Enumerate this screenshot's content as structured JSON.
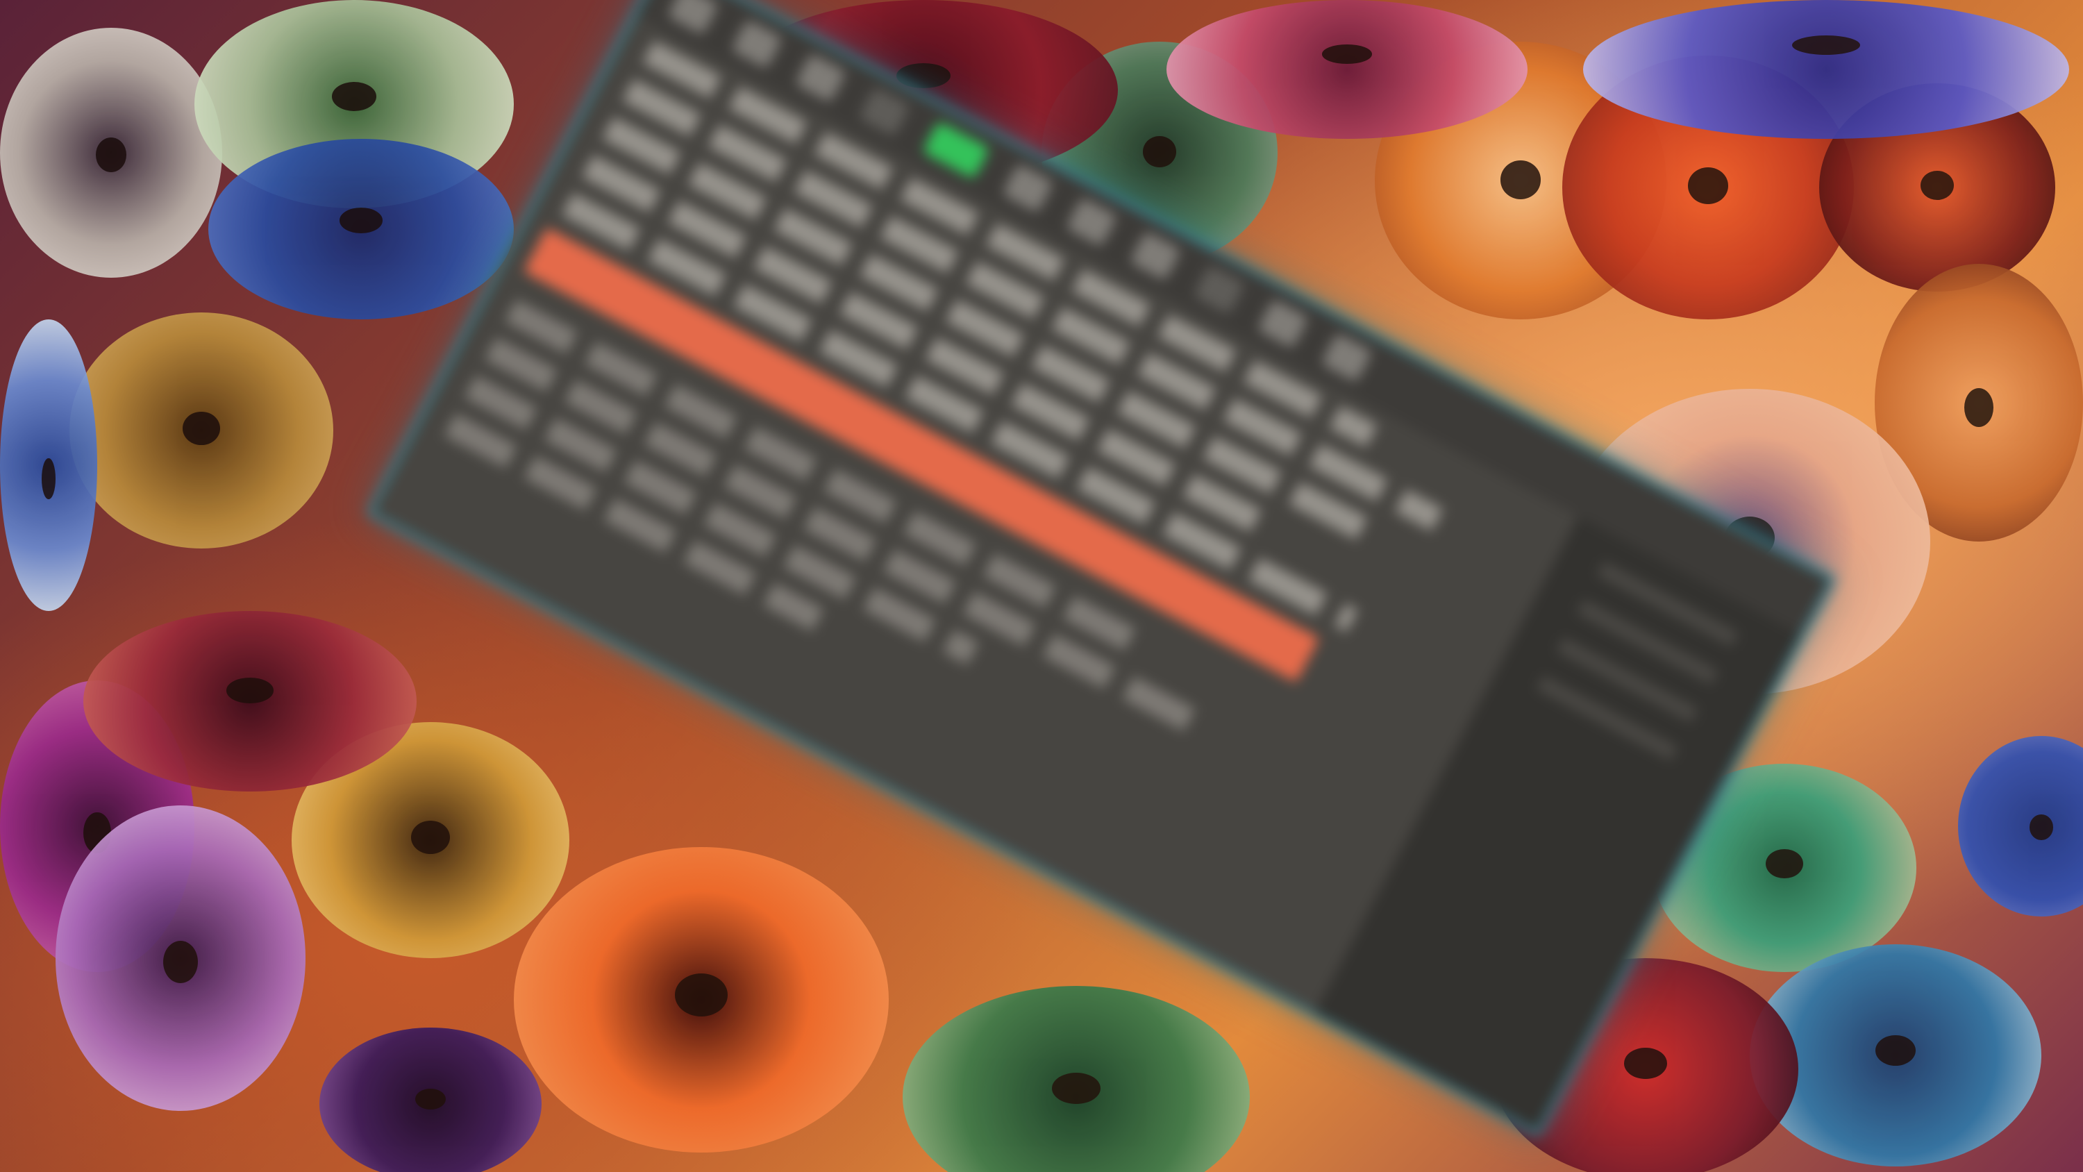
{
  "window": {
    "toolbar": {
      "buttons": [
        {
          "icon": "tool-icon-1",
          "state": "normal"
        },
        {
          "icon": "tool-icon-2",
          "state": "normal"
        },
        {
          "icon": "tool-icon-3",
          "state": "normal"
        },
        {
          "icon": "tool-icon-4",
          "state": "dim"
        },
        {
          "icon": "tool-icon-5",
          "state": "active"
        },
        {
          "icon": "tool-icon-6",
          "state": "normal"
        },
        {
          "icon": "tool-icon-7",
          "state": "normal"
        },
        {
          "icon": "tool-icon-8",
          "state": "normal"
        },
        {
          "icon": "tool-icon-9",
          "state": "dim"
        },
        {
          "icon": "tool-icon-10",
          "state": "normal"
        },
        {
          "icon": "tool-icon-11",
          "state": "normal"
        }
      ],
      "active_color": "#34c25a"
    },
    "content": {
      "lines_before": [
        "",
        "",
        "",
        "",
        ""
      ],
      "highlight_color": "#e46a4a",
      "lines_after": [
        "",
        "",
        "",
        ""
      ]
    },
    "frame_color": "#3b8a9a",
    "background_color": "#474541"
  }
}
